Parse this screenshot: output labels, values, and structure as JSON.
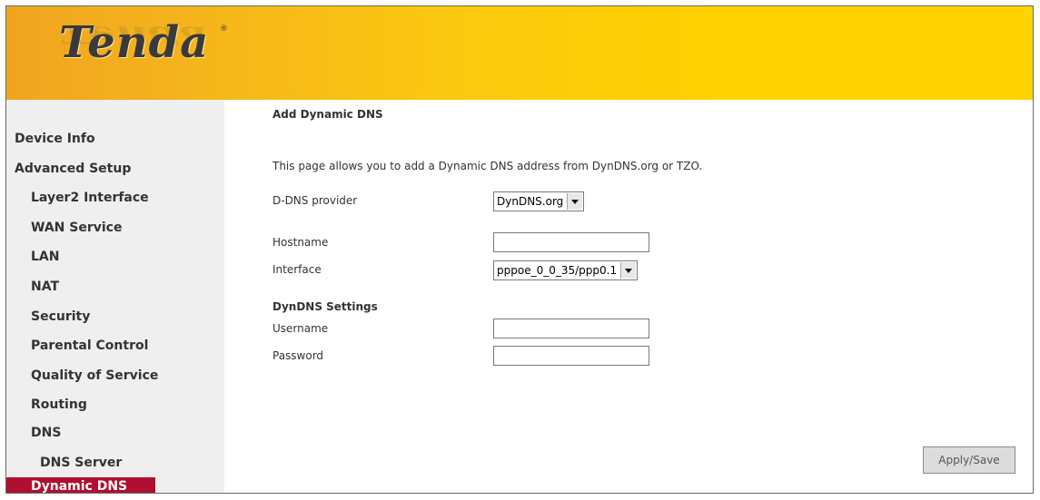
{
  "brand": {
    "logo_text": "Tenda",
    "registered_mark": "®"
  },
  "sidebar": {
    "items": [
      {
        "label": "Device Info"
      },
      {
        "label": "Advanced Setup"
      },
      {
        "label": "Layer2 Interface"
      },
      {
        "label": "WAN Service"
      },
      {
        "label": "LAN"
      },
      {
        "label": "NAT"
      },
      {
        "label": "Security"
      },
      {
        "label": "Parental Control"
      },
      {
        "label": "Quality of Service"
      },
      {
        "label": "Routing"
      },
      {
        "label": "DNS"
      },
      {
        "label": "DNS Server"
      },
      {
        "label": "Dynamic DNS",
        "active": true
      }
    ]
  },
  "main": {
    "title": "Add Dynamic DNS",
    "description": "This page allows you to add a Dynamic DNS address from DynDNS.org or TZO.",
    "provider": {
      "label": "D-DNS provider",
      "value": "DynDNS.org"
    },
    "hostname": {
      "label": "Hostname",
      "value": ""
    },
    "interface": {
      "label": "Interface",
      "value": "pppoe_0_0_35/ppp0.1"
    },
    "settings_title": "DynDNS Settings",
    "username": {
      "label": "Username",
      "value": ""
    },
    "password": {
      "label": "Password",
      "value": ""
    },
    "apply_label": "Apply/Save"
  },
  "colors": {
    "banner_start": "#f0a420",
    "banner_end": "#ffd300",
    "active_nav": "#b01030",
    "sidebar_bg": "#efefef"
  }
}
